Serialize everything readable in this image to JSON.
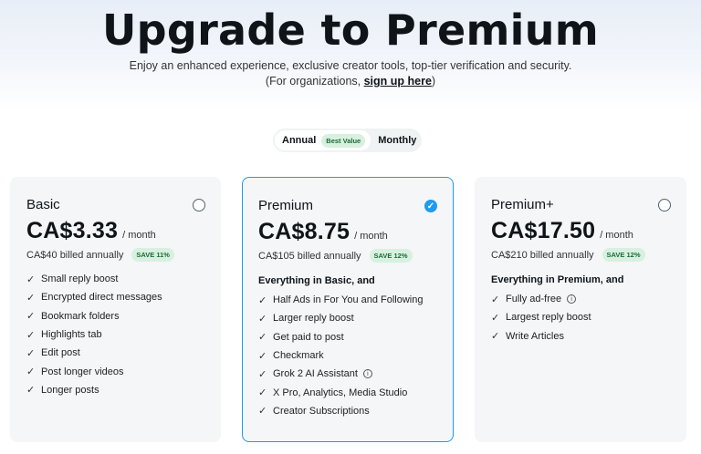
{
  "header": {
    "title": "Upgrade to Premium",
    "subtitle": "Enjoy an enhanced experience, exclusive creator tools, top-tier verification and security.",
    "org_prefix": "(For organizations, ",
    "org_link": "sign up here",
    "org_suffix": ")"
  },
  "billing_toggle": {
    "annual_label": "Annual",
    "best_value_badge": "Best Value",
    "monthly_label": "Monthly",
    "selected": "Annual"
  },
  "plans": [
    {
      "name": "Basic",
      "selected": false,
      "price": "CA$3.33",
      "per": "/ month",
      "billed": "CA$40 billed annually",
      "save": "SAVE 11%",
      "everything": "",
      "features": [
        "Small reply boost",
        "Encrypted direct messages",
        "Bookmark folders",
        "Highlights tab",
        "Edit post",
        "Post longer videos",
        "Longer posts"
      ]
    },
    {
      "name": "Premium",
      "selected": true,
      "price": "CA$8.75",
      "per": "/ month",
      "billed": "CA$105 billed annually",
      "save": "SAVE 12%",
      "everything": "Everything in Basic, and",
      "features": [
        "Half Ads in For You and Following",
        "Larger reply boost",
        "Get paid to post",
        "Checkmark",
        "Grok 2 AI Assistant",
        "X Pro, Analytics, Media Studio",
        "Creator Subscriptions"
      ]
    },
    {
      "name": "Premium+",
      "selected": false,
      "price": "CA$17.50",
      "per": "/ month",
      "billed": "CA$210 billed annually",
      "save": "SAVE 12%",
      "everything": "Everything in Premium, and",
      "features": [
        "Fully ad-free",
        "Largest reply boost",
        "Write Articles"
      ]
    }
  ],
  "icons": {
    "check": "check-icon",
    "info": "info-icon",
    "radio_checked": "check-circle-icon"
  },
  "colors": {
    "accent": "#1d9bf0",
    "save_bg": "#d8f0df",
    "save_text": "#1c6b38"
  }
}
